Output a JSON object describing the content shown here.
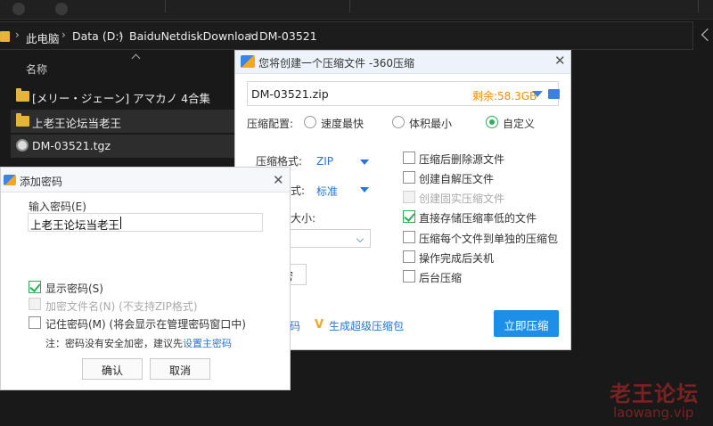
{
  "explorer": {
    "breadcrumb": [
      "此电脑",
      "Data (D:)",
      "BaiduNetdiskDownload",
      "DM-03521"
    ],
    "column_name": "名称",
    "files": [
      {
        "name": "[メリー・ジェーン] アマカノ 4合集",
        "icon": "folder-icon",
        "selected": false
      },
      {
        "name": "上老王论坛当老王",
        "icon": "folder-icon",
        "selected": true
      },
      {
        "name": "DM-03521.tgz",
        "icon": "archive-icon",
        "selected": true
      }
    ]
  },
  "compress_dialog": {
    "title": "您将创建一个压缩文件 -360压缩",
    "filename": "DM-03521.zip",
    "free_space": "剩余:58.3GB",
    "config_label": "压缩配置:",
    "presets": [
      {
        "label": "速度最快",
        "checked": false
      },
      {
        "label": "体积最小",
        "checked": false
      },
      {
        "label": "自定义",
        "checked": true
      }
    ],
    "format_label": "压缩格式:",
    "format_value": "ZIP",
    "level_label_fragment": "式:",
    "level_value": "标准",
    "split_label_fragment": "大小:",
    "options": [
      {
        "label": "压缩后删除源文件",
        "checked": false,
        "disabled": false
      },
      {
        "label": "创建自解压文件",
        "checked": false,
        "disabled": false
      },
      {
        "label": "创建固实压缩文件",
        "checked": false,
        "disabled": true
      },
      {
        "label": "直接存储压缩率低的文件",
        "checked": true,
        "disabled": false
      },
      {
        "label": "压缩每个文件到单独的压缩包",
        "checked": false,
        "disabled": false
      },
      {
        "label": "操作完成后关机",
        "checked": false,
        "disabled": false
      },
      {
        "label": "后台压缩",
        "checked": false,
        "disabled": false
      }
    ],
    "small_button_fragment": "密",
    "password_link_fragment": "码",
    "super_compress_label": "生成超级压缩包",
    "start_button": "立即压缩"
  },
  "password_dialog": {
    "title": "添加密码",
    "input_label": "输入密码(E)",
    "password_value": "上老王论坛当老王",
    "show_password": {
      "label": "显示密码(S)",
      "checked": true
    },
    "encrypt_names": {
      "label": "加密文件名(N) (不支持ZIP格式)",
      "checked": false,
      "disabled": true
    },
    "remember": {
      "label": "记住密码(M) (将会显示在管理密码窗口中)",
      "checked": false
    },
    "note_prefix": "注：密码没有安全加密，建议先",
    "note_link": "设置主密码",
    "ok_button": "确认",
    "cancel_button": "取消"
  },
  "watermark": {
    "line1": "老王论坛",
    "line2": "laowang.vip"
  },
  "colors": {
    "accent": "#1e8fe8",
    "check": "#2fae5a",
    "free_space": "#f08c00",
    "watermark": "#7a2222"
  }
}
